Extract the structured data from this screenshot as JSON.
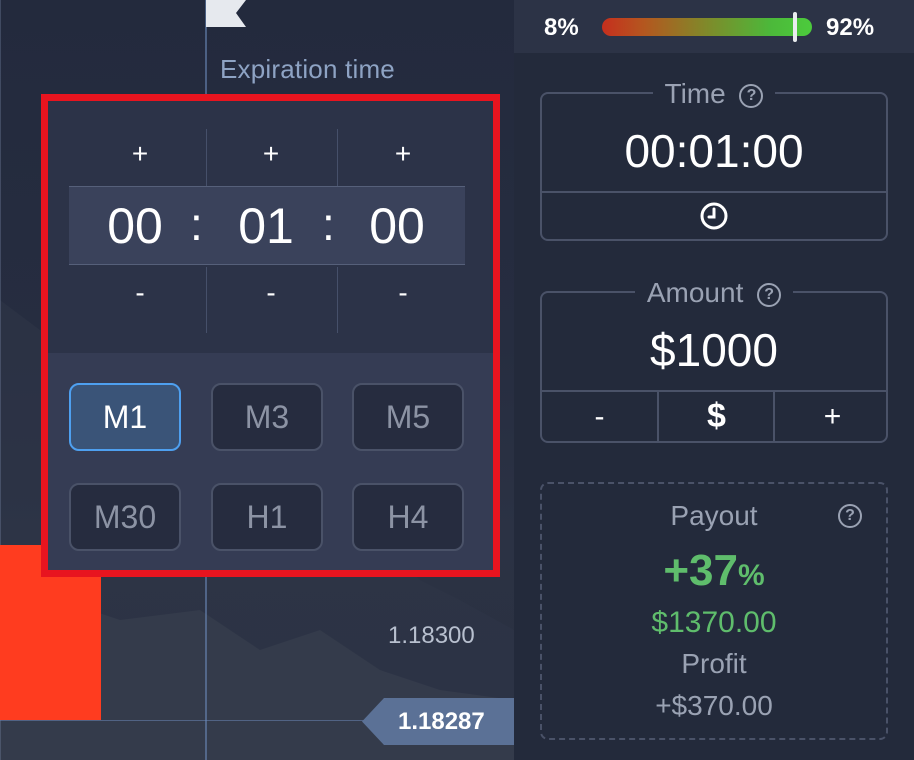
{
  "chart": {
    "expiration_label": "Expiration time",
    "price_level_label": "1.18300",
    "current_price": "1.18287",
    "colors": {
      "candle_bearish": "#ff3c1f",
      "price_tag": "#5b7196"
    }
  },
  "expiration_popup": {
    "plus_label": "+",
    "minus_label": "-",
    "separator": ":",
    "hours": "00",
    "minutes": "01",
    "seconds": "00",
    "highlight_color": "#e8141f",
    "presets": [
      {
        "label": "M1",
        "active": true
      },
      {
        "label": "M3",
        "active": false
      },
      {
        "label": "M5",
        "active": false
      },
      {
        "label": "M30",
        "active": false
      },
      {
        "label": "H1",
        "active": false
      },
      {
        "label": "H4",
        "active": false
      }
    ]
  },
  "sentiment": {
    "sell_percent": "8%",
    "buy_percent": "92%",
    "buy_fraction": 0.92
  },
  "time_box": {
    "label": "Time",
    "help_icon": "?",
    "value": "00:01:00",
    "clock_icon": "clock-icon"
  },
  "amount_box": {
    "label": "Amount",
    "help_icon": "?",
    "value": "$1000",
    "minus_label": "-",
    "currency_label": "$",
    "plus_label": "+"
  },
  "payout": {
    "title": "Payout",
    "help_icon": "?",
    "percent_value": "+37",
    "percent_symbol": "%",
    "amount": "$1370.00",
    "profit_label": "Profit",
    "profit_value": "+$370.00",
    "accent_color": "#5fbd6c"
  }
}
